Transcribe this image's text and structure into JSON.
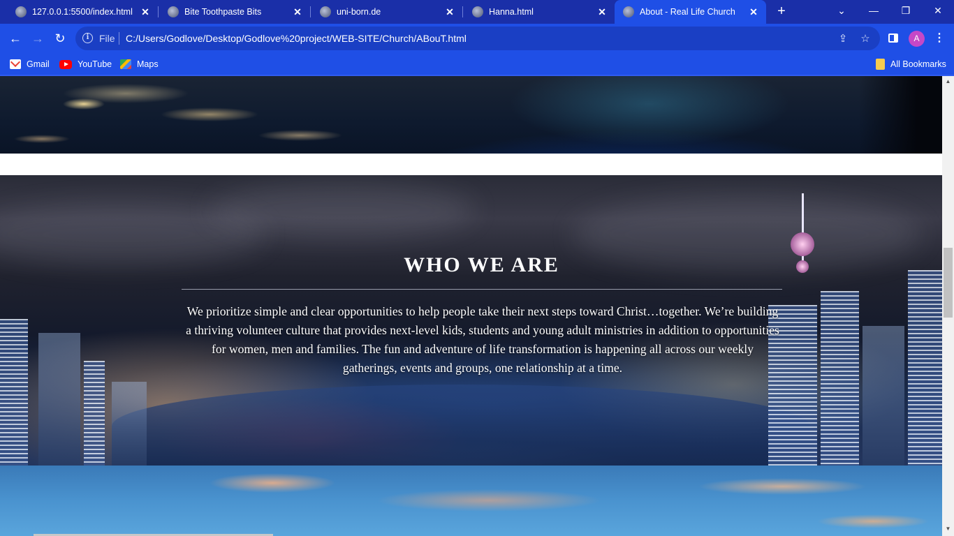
{
  "browser": {
    "tabs": [
      {
        "title": "127.0.0.1:5500/index.html",
        "active": false
      },
      {
        "title": "Bite Toothpaste Bits",
        "active": false
      },
      {
        "title": "uni-born.de",
        "active": false
      },
      {
        "title": "Hanna.html",
        "active": false
      },
      {
        "title": "About - Real Life Church",
        "active": true
      }
    ],
    "new_tab": "+",
    "address": {
      "scheme": "File",
      "url": "C:/Users/Godlove/Desktop/Godlove%20project/WEB-SITE/Church/ABouT.html"
    },
    "profile_initial": "A",
    "bookmarks": [
      {
        "label": "Gmail",
        "icon": "gmail-icon"
      },
      {
        "label": "YouTube",
        "icon": "youtube-icon"
      },
      {
        "label": "Maps",
        "icon": "maps-icon"
      }
    ],
    "all_bookmarks": "All Bookmarks",
    "colors": {
      "tabbar": "#1a2fa8",
      "toolbar": "#1f4fe6"
    }
  },
  "page": {
    "who_we_are": {
      "title": "WHO WE ARE",
      "body": "We prioritize simple and clear opportunities to help people take their next steps toward Christ…together. We’re building a thriving volunteer culture that provides next-level kids, students and young adult ministries in addition to opportunities for women, men and families. The fun and adventure of life transformation is happening all across our weekly gatherings, events and groups, one relationship at a time."
    }
  }
}
